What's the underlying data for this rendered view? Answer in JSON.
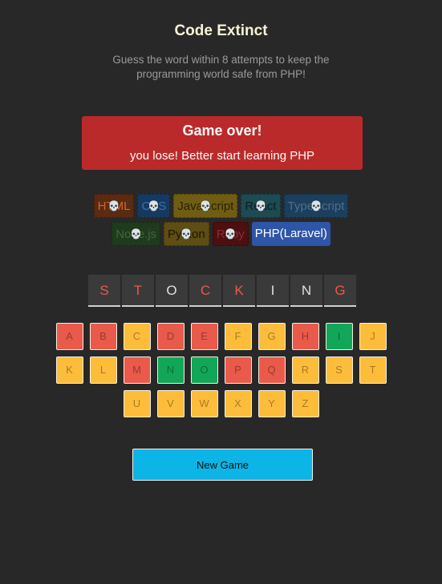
{
  "header": {
    "title": "Code Extinct",
    "subtitle": "Guess the word within 8 attempts to keep the programming world safe from PHP!"
  },
  "status": {
    "title": "Game over!",
    "message": "you lose! Better start learning PHP"
  },
  "languages": [
    [
      {
        "name": "HTML",
        "bg": "#5a2a12",
        "color": "#d0662f",
        "lost": true
      },
      {
        "name": "CSS",
        "bg": "#163a5f",
        "color": "#3a6fb0",
        "lost": true
      },
      {
        "name": "JavaScript",
        "bg": "#6e5d13",
        "color": "#2a2300",
        "lost": true
      },
      {
        "name": "React",
        "bg": "#1e4a52",
        "color": "#0b1e22",
        "lost": true
      },
      {
        "name": "TypeScript",
        "bg": "#1c3f5e",
        "color": "#4e6f8a",
        "lost": true
      }
    ],
    [
      {
        "name": "Node.js",
        "bg": "#1f3a1c",
        "color": "#3c6b37",
        "lost": true
      },
      {
        "name": "Python",
        "bg": "#5e4d14",
        "color": "#1c1700",
        "lost": true
      },
      {
        "name": "Ruby",
        "bg": "#4d0f0f",
        "color": "#8a3030",
        "lost": true
      },
      {
        "name": "PHP(Laravel)",
        "bg": "#2e55a7",
        "color": "#ffffff",
        "lost": false
      }
    ]
  ],
  "skull_icon": "💀",
  "word": [
    {
      "letter": "S",
      "state": "wrong"
    },
    {
      "letter": "T",
      "state": "wrong"
    },
    {
      "letter": "O",
      "state": "right"
    },
    {
      "letter": "C",
      "state": "wrong"
    },
    {
      "letter": "K",
      "state": "wrong"
    },
    {
      "letter": "I",
      "state": "right"
    },
    {
      "letter": "N",
      "state": "right"
    },
    {
      "letter": "G",
      "state": "wrong"
    }
  ],
  "keyboard": [
    [
      {
        "key": "A",
        "state": "incorrect"
      },
      {
        "key": "B",
        "state": "incorrect"
      },
      {
        "key": "C",
        "state": "available"
      },
      {
        "key": "D",
        "state": "incorrect"
      },
      {
        "key": "E",
        "state": "incorrect"
      },
      {
        "key": "F",
        "state": "available"
      },
      {
        "key": "G",
        "state": "available"
      },
      {
        "key": "H",
        "state": "incorrect"
      },
      {
        "key": "I",
        "state": "correct"
      },
      {
        "key": "J",
        "state": "available"
      }
    ],
    [
      {
        "key": "K",
        "state": "available"
      },
      {
        "key": "L",
        "state": "available"
      },
      {
        "key": "M",
        "state": "incorrect"
      },
      {
        "key": "N",
        "state": "correct"
      },
      {
        "key": "O",
        "state": "correct"
      },
      {
        "key": "P",
        "state": "incorrect"
      },
      {
        "key": "Q",
        "state": "incorrect"
      },
      {
        "key": "R",
        "state": "available"
      },
      {
        "key": "S",
        "state": "available"
      },
      {
        "key": "T",
        "state": "available"
      }
    ],
    [
      {
        "key": "U",
        "state": "available"
      },
      {
        "key": "V",
        "state": "available"
      },
      {
        "key": "W",
        "state": "available"
      },
      {
        "key": "X",
        "state": "available"
      },
      {
        "key": "Y",
        "state": "available"
      },
      {
        "key": "Z",
        "state": "available"
      }
    ]
  ],
  "new_game_label": "New Game"
}
